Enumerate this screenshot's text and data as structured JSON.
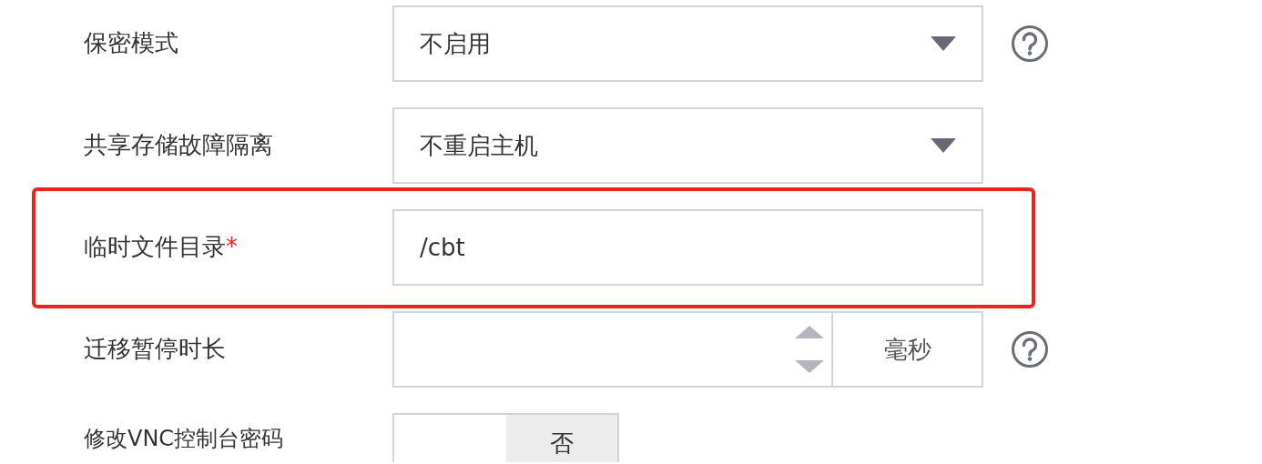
{
  "fields": [
    {
      "kind": "select",
      "label": "保密模式",
      "value": "不启用",
      "help": true,
      "highlighted": false
    },
    {
      "kind": "select",
      "label": "共享存储故障隔离",
      "value": "不重启主机",
      "help": false,
      "highlighted": false
    },
    {
      "kind": "text",
      "label": "临时文件目录",
      "required_mark": "*",
      "value": "/cbt",
      "help": false,
      "highlighted": true
    },
    {
      "kind": "number",
      "label": "迁移暂停时长",
      "unit": "毫秒",
      "help": true,
      "highlighted": false
    },
    {
      "kind": "toggle",
      "label": "修改VNC控制台密码",
      "toggle_label": "否",
      "on": false,
      "help": false,
      "highlighted": false
    }
  ]
}
